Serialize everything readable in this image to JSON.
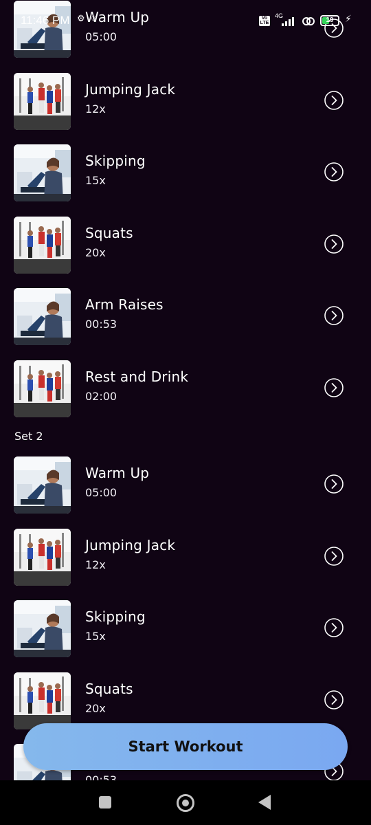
{
  "status_bar": {
    "time": "11:46 PM",
    "volte": "Vo LTE",
    "network": "4G",
    "battery": "19"
  },
  "workout": {
    "rows_before": [
      {
        "title": "Warm Up",
        "sub": "05:00",
        "img": "treadmill"
      },
      {
        "title": "Jumping Jack",
        "sub": "12x",
        "img": "group"
      },
      {
        "title": "Skipping",
        "sub": "15x",
        "img": "treadmill"
      },
      {
        "title": "Squats",
        "sub": "20x",
        "img": "group"
      },
      {
        "title": "Arm Raises",
        "sub": "00:53",
        "img": "treadmill"
      },
      {
        "title": "Rest and Drink",
        "sub": "02:00",
        "img": "group"
      }
    ],
    "set_label": "Set 2",
    "rows_after": [
      {
        "title": "Warm Up",
        "sub": "05:00",
        "img": "treadmill"
      },
      {
        "title": "Jumping Jack",
        "sub": "12x",
        "img": "group"
      },
      {
        "title": "Skipping",
        "sub": "15x",
        "img": "treadmill"
      },
      {
        "title": "Squats",
        "sub": "20x",
        "img": "group"
      },
      {
        "title": "",
        "sub": "00:53",
        "img": "treadmill"
      }
    ]
  },
  "start_button": "Start Workout",
  "icons": {
    "row_action": "chevron-right-circle-icon",
    "nav_recents": "square-icon",
    "nav_home": "circle-icon",
    "nav_back": "triangle-back-icon"
  },
  "colors": {
    "background": "#100414",
    "button": "#7eb0ef"
  }
}
